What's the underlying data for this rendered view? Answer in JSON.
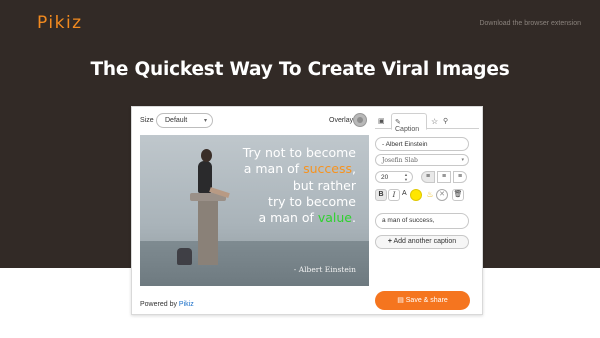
{
  "brand": {
    "logo": "Pikiz",
    "logo_color": "#f28a1f"
  },
  "header": {
    "extension_link": "Download the browser extension"
  },
  "hero": {
    "headline": "The Quickest Way To Create Viral Images",
    "background": "#322a26"
  },
  "editor": {
    "size_label": "Size",
    "size_value": "Default",
    "overlay_label": "Overlay",
    "quote": {
      "line1": "Try not to become",
      "line2_prefix": "a man of ",
      "line2_highlight": "success",
      "line2_suffix": ",",
      "line3": "but rather",
      "line4": "try to become",
      "line5_prefix": "a man of ",
      "line5_highlight": "value",
      "line5_suffix": ".",
      "author": "- Albert Einstein",
      "highlight_colors": [
        "#f7931e",
        "#2fd12f"
      ]
    },
    "tabs": {
      "image_icon": "image-icon",
      "caption_label": "Caption",
      "star_icon": "star-icon",
      "wrench_icon": "wrench-icon"
    },
    "author_field": "- Albert Einstein",
    "font_value": "Josefin Slab",
    "font_size": "20",
    "text_color_label": "A",
    "caption_text": "a man of success,",
    "add_caption_label": "Add another caption",
    "powered_by_prefix": "Powered by ",
    "powered_by_brand": "Pikiz",
    "save_label": "Save & share",
    "accent": "#f5751f"
  }
}
